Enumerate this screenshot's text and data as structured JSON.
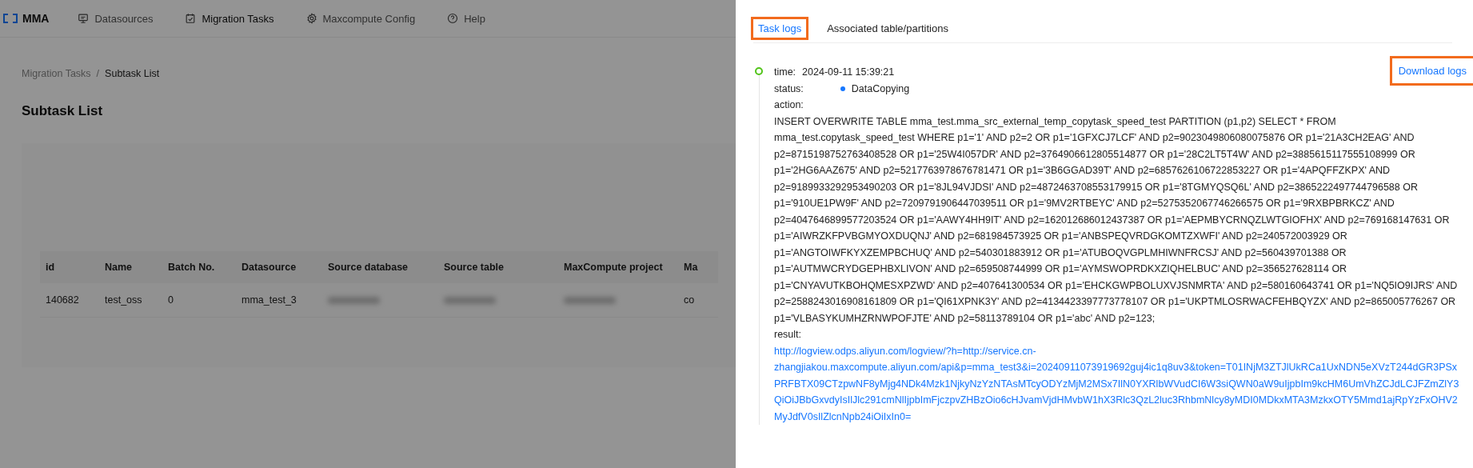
{
  "nav": {
    "logo": "MMA",
    "items": [
      {
        "label": "Datasources",
        "selected": false
      },
      {
        "label": "Migration Tasks",
        "selected": true
      },
      {
        "label": "Maxcompute Config",
        "selected": false
      },
      {
        "label": "Help",
        "selected": false
      }
    ]
  },
  "breadcrumb": {
    "items": [
      "Migration Tasks",
      "Subtask List"
    ],
    "separator": "/"
  },
  "page_title": "Subtask List",
  "table": {
    "columns": [
      "id",
      "Name",
      "Batch No.",
      "Datasource",
      "Source database",
      "Source table",
      "MaxCompute project",
      "Ma"
    ],
    "rows": [
      {
        "cells": [
          "140682",
          "test_oss",
          "0",
          "mma_test_3",
          null,
          null,
          null,
          "co"
        ]
      }
    ]
  },
  "drawer": {
    "tabs": [
      {
        "label": "Task logs",
        "selected": true,
        "highlighted": true
      },
      {
        "label": "Associated table/partitions",
        "selected": false,
        "highlighted": false
      }
    ],
    "download": {
      "label": "Download logs",
      "highlighted": true
    },
    "log": {
      "time_label": "time:",
      "time": "2024-09-11 15:39:21",
      "status_label": "status:",
      "status": {
        "label": "DataCopying",
        "kind": "running"
      },
      "action_label": "action:",
      "action": "INSERT OVERWRITE TABLE mma_test.mma_src_external_temp_copytask_speed_test PARTITION (p1,p2) SELECT * FROM mma_test.copytask_speed_test WHERE p1='1' AND p2=2 OR p1='1GFXCJ7LCF' AND p2=9023049806080075876 OR p1='21A3CH2EAG' AND p2=8715198752763408528 OR p1='25W4I057DR' AND p2=3764906612805514877 OR p1='28C2LT5T4W' AND p2=3885615117555108999 OR p1='2HG6AAZ675' AND p2=5217763978676781471 OR p1='3B6GGAD39T' AND p2=6857626106722853227 OR p1='4APQFFZKPX' AND p2=9189933292953490203 OR p1='8JL94VJDSI' AND p2=4872463708553179915 OR p1='8TGMYQSQ6L' AND p2=3865222497744796588 OR p1='910UE1PW9F' AND p2=7209791906447039511 OR p1='9MV2RTBEYC' AND p2=5275352067746266575 OR p1='9RXBPBRKCZ' AND p2=4047646899577203524 OR p1='AAWY4HH9IT' AND p2=162012686012437387 OR p1='AEPMBYCRNQZLWTGIOFHX' AND p2=769168147631 OR p1='AIWRZKFPVBGMYOXDUQNJ' AND p2=681984573925 OR p1='ANBSPEQVRDGKOMTZXWFI' AND p2=240572003929 OR p1='ANGTOIWFKYXZEMPBCHUQ' AND p2=540301883912 OR p1='ATUBOQVGPLMHIWNFRCSJ' AND p2=560439701388 OR p1='AUTMWCRYDGEPHBXLIVON' AND p2=659508744999 OR p1='AYMSWOPRDKXZIQHELBUC' AND p2=356527628114 OR p1='CNYAVUTKBOHQMESXPZWD' AND p2=407641300534 OR p1='EHCKGWPBOLUXVJSNMRTA' AND p2=580160643741 OR p1='NQ5IO9IJRS' AND p2=2588243016908161809 OR p1='QI61XPNK3Y' AND p2=4134423397773778107 OR p1='UKPTMLOSRWACFEHBQYZX' AND p2=865005776267 OR p1='VLBASYKUMHZRNWPOFJTE' AND p2=58113789104 OR p1='abc' AND p2=123;",
      "result_label": "result:",
      "result": "http://logview.odps.aliyun.com/logview/?h=http://service.cn-zhangjiakou.maxcompute.aliyun.com/api&p=mma_test3&i=20240911073919692guj4ic1q8uv3&token=T01INjM3ZTJlUkRCa1UxNDN5eXVzT244dGR3PSxPRFBTX09CTzpwNF8yMjg4NDk4Mzk1NjkyNzYzNTAsMTcyODYzMjM2MSx7IlN0YXRlbWVudCI6W3siQWN0aW9uIjpbIm9kcHM6UmVhZCJdLCJFZmZlY3QiOiJBbGxvdyIsIlJlc291cmNlIjpbImFjczpvZHBzOio6cHJvamVjdHMvbW1hX3Rlc3QzL2luc3RhbmNlcy8yMDI0MDkxMTA3MzkxOTY5Mmd1ajRpYzFxOHV2MyJdfV0sIlZlcnNpb24iOiIxIn0="
    }
  }
}
